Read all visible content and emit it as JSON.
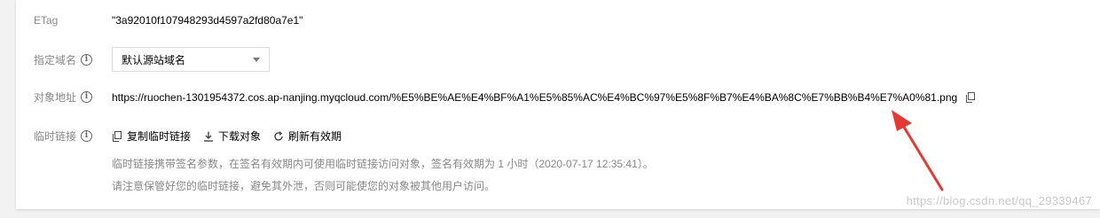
{
  "etag": {
    "label": "ETag",
    "value": "\"3a92010f107948293d4597a2fd80a7e1\""
  },
  "domain": {
    "label": "指定域名",
    "selected": "默认源站域名"
  },
  "object_address": {
    "label": "对象地址",
    "url": "https://ruochen-1301954372.cos.ap-nanjing.myqcloud.com/%E5%BE%AE%E4%BF%A1%E5%85%AC%E4%BC%97%E5%8F%B7%E4%BA%8C%E7%BB%B4%E7%A0%81.png"
  },
  "temp_link": {
    "label": "临时链接",
    "actions": [
      {
        "label": "复制临时链接",
        "icon": "copy-icon"
      },
      {
        "label": "下载对象",
        "icon": "download-icon"
      },
      {
        "label": "刷新有效期",
        "icon": "refresh-icon"
      }
    ],
    "hint1": "临时链接携带签名参数，在签名有效期内可使用临时链接访问对象，签名有效期为 1 小时（2020-07-17 12:35:41）。",
    "hint2": "请注意保管好您的临时链接，避免其外泄，否则可能使您的对象被其他用户访问。"
  },
  "watermark": "https://blog.csdn.net/qq_29339467",
  "colors": {
    "arrow": "#e53935",
    "label": "#888888",
    "background": "#f2f2f2"
  }
}
